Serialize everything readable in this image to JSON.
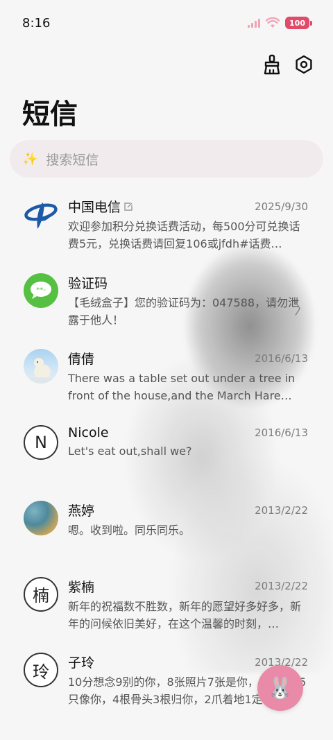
{
  "status": {
    "time": "8:16",
    "battery": "100"
  },
  "header": {
    "title": "短信"
  },
  "search": {
    "placeholder": "搜索短信"
  },
  "conversations": [
    {
      "name": "中国电信",
      "date": "2025/9/30",
      "preview": "欢迎参加积分兑换话费活动，每500分可兑换话费5元，兑换话费请回复106或jfdh#话费…",
      "avatar": "china-telecom-logo"
    },
    {
      "name": "验证码",
      "date": "",
      "preview": "【毛绒盒子】您的验证码为：047588，请勿泄露于他人！",
      "avatar": "message-bubble-icon"
    },
    {
      "name": "倩倩",
      "date": "2016/6/13",
      "preview": "There was a table set out under a tree in front of the house,and the March Hare an…",
      "avatar": "polar-bear-photo"
    },
    {
      "name": "Nicole",
      "date": "2016/6/13",
      "preview": "Let's eat out,shall we?",
      "avatar_text": "N"
    },
    {
      "name": "燕婷",
      "date": "2013/2/22",
      "preview": "嗯。收到啦。同乐同乐。",
      "avatar": "landscape-photo"
    },
    {
      "name": "紫楠",
      "date": "2013/2/22",
      "preview": "新年的祝福数不胜数，新年的愿望好多好多，新年的问候依旧美好，在这个温馨的时刻，…",
      "avatar_text": "楠"
    },
    {
      "name": "子玲",
      "date": "2013/2/22",
      "preview": "10分想念9别的你，8张照片7张是你，6只小狗5只像你，4根骨头3根归你，2爪着地1定…",
      "avatar_text": "玲"
    }
  ],
  "icons": {
    "clean": "broom-icon",
    "settings": "settings-icon",
    "fab": "bunny-icon"
  },
  "colors": {
    "accent": "#e98aa8",
    "battery": "#e14b6a",
    "search_bg": "#f2ebee"
  }
}
